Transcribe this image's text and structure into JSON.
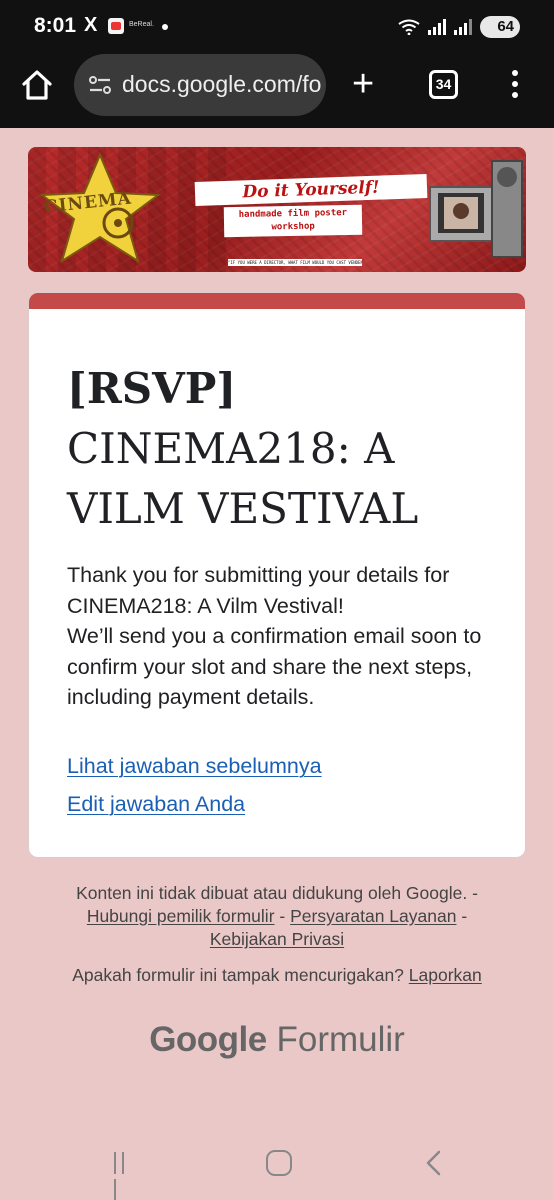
{
  "status_bar": {
    "time": "8:01",
    "x_icon": "X",
    "bereal_label": "BeReal.",
    "wifi_level": "5",
    "battery": "64"
  },
  "browser": {
    "url": "docs.google.com/fo",
    "tab_count": "34"
  },
  "banner": {
    "logo_text": "CINEMA",
    "headline": "Do it Yourself!",
    "subline_1": "handmade film poster",
    "subline_2": "workshop",
    "quote": "\"IF YOU WERE A DIRECTOR, WHAT FILM WOULD YOU CAST VENDEN IN?\"",
    "accent_color": "#b92b2b"
  },
  "form": {
    "title_tag": "[RSVP]",
    "title_rest": "CINEMA218: A VILM VESTIVAL",
    "message_1": "Thank you for submitting your details for CINEMA218: A Vilm Vestival!",
    "message_2": "We’ll send you a confirmation email soon to confirm your slot and share the next steps, including payment details.",
    "link_previous": "Lihat jawaban sebelumnya",
    "link_edit": "Edit jawaban Anda",
    "header_color": "#c44a4a"
  },
  "footer": {
    "disclaimer": "Konten ini tidak dibuat atau didukung oleh Google.",
    "sep": " - ",
    "contact_owner": "Hubungi pemilik formulir",
    "terms": "Persyaratan Layanan",
    "privacy": "Kebijakan Privasi",
    "suspicious": "Apakah formulir ini tampak mencurigakan?",
    "report": "Laporkan",
    "logo_google": "Google",
    "logo_forms": "Formulir"
  },
  "nav": {
    "recent": "recent-apps-icon",
    "home": "home-icon",
    "back": "back-icon"
  }
}
